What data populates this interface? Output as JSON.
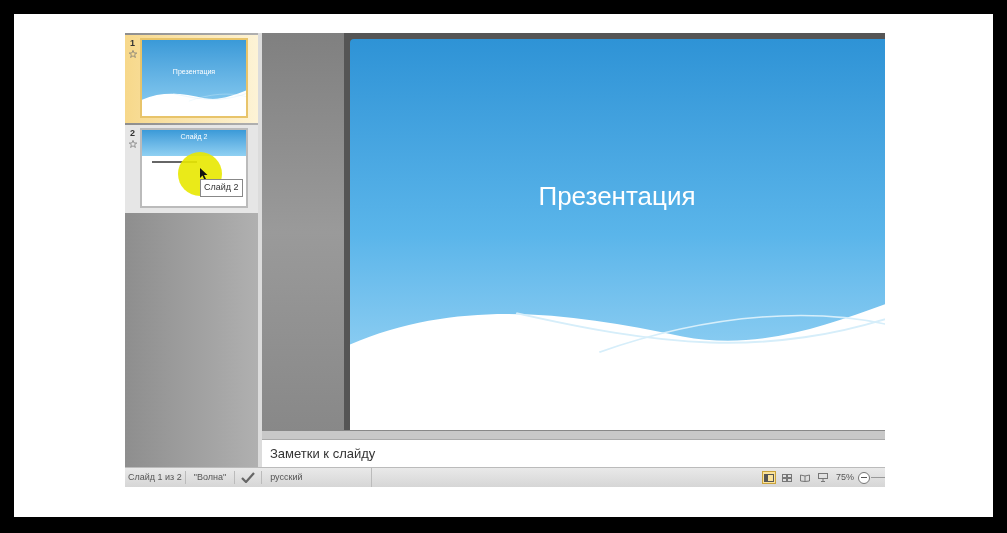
{
  "thumbnails": [
    {
      "number": "1",
      "title": "Презентация",
      "selected": true
    },
    {
      "number": "2",
      "title": "Слайд 2",
      "selected": false
    }
  ],
  "tooltip": "Слайд 2",
  "slide": {
    "title": "Презентация"
  },
  "notes": {
    "text": "Заметки к слайду"
  },
  "status_bar": {
    "slide_info": "Слайд 1 из 2",
    "theme": "\"Волна\"",
    "language": "русский",
    "views": [
      {
        "kind": "normal",
        "selected": true
      },
      {
        "kind": "sorter",
        "selected": false
      },
      {
        "kind": "reading",
        "selected": false
      },
      {
        "kind": "slideshow",
        "selected": false
      }
    ],
    "zoom": "75%"
  }
}
